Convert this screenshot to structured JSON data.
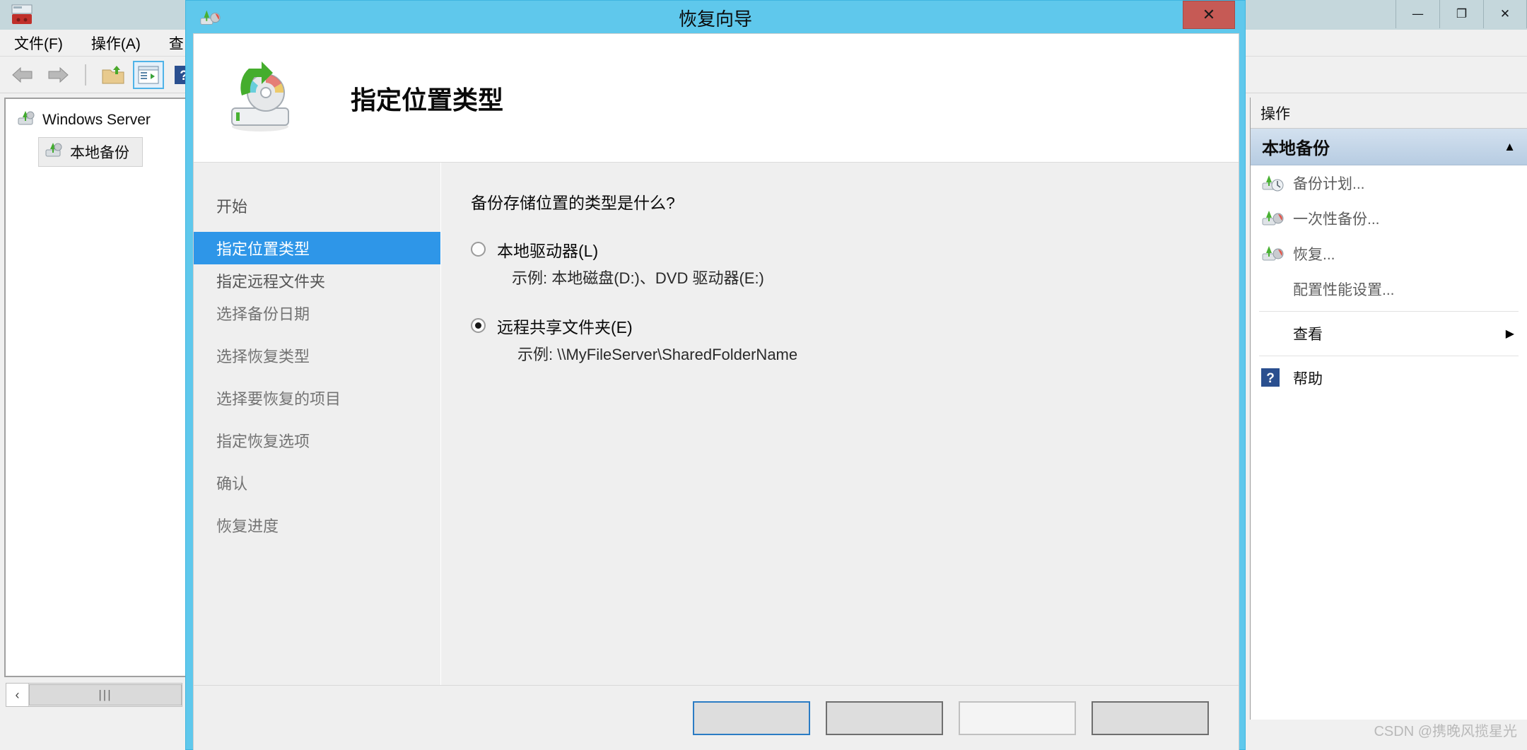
{
  "mmc": {
    "app_icon": "server-backup-icon",
    "window_controls": {
      "minimize": "—",
      "maximize": "❐",
      "close": "✕"
    },
    "menus": [
      {
        "label": "文件(F)",
        "name": "menu-file"
      },
      {
        "label": "操作(A)",
        "name": "menu-action"
      },
      {
        "label": "查",
        "name": "menu-view"
      }
    ],
    "toolbar": [
      {
        "name": "back-arrow-icon"
      },
      {
        "name": "forward-arrow-icon"
      },
      {
        "name": "show-hide-tree-icon"
      },
      {
        "name": "properties-window-icon"
      },
      {
        "name": "help-icon"
      }
    ],
    "tree": [
      {
        "label": "Windows Server",
        "name": "tree-item-windows-server"
      },
      {
        "label": "本地备份",
        "name": "tree-item-local-backup"
      }
    ],
    "scrollbar": {
      "left_arrow": "‹",
      "thumb_glyph": "|||"
    }
  },
  "actions": {
    "header": "操作",
    "group_title": "本地备份",
    "collapse_caret": "▲",
    "items": [
      {
        "label": "备份计划...",
        "icon": "backup-schedule-icon",
        "name": "action-backup-schedule",
        "dimmed": true
      },
      {
        "label": "一次性备份...",
        "icon": "backup-once-icon",
        "name": "action-backup-once",
        "dimmed": true
      },
      {
        "label": "恢复...",
        "icon": "recover-icon",
        "name": "action-recover",
        "dimmed": true
      },
      {
        "label": "配置性能设置...",
        "icon": "",
        "name": "action-configure-performance",
        "dimmed": true
      },
      {
        "label": "查看",
        "icon": "",
        "name": "action-view",
        "dimmed": false,
        "submenu": "▶"
      },
      {
        "label": "帮助",
        "icon": "help-icon",
        "name": "action-help",
        "dimmed": false
      }
    ]
  },
  "wizard": {
    "title": "恢复向导",
    "titlebar_icon": "recover-icon",
    "close_label": "✕",
    "header_icon": "recovery-drive-icon",
    "header_title": "指定位置类型",
    "steps": [
      {
        "label": "开始",
        "name": "wizard-step-getting-started",
        "state": "done"
      },
      {
        "label": "指定位置类型",
        "name": "wizard-step-specify-location-type",
        "state": "current"
      },
      {
        "label": "指定远程文件夹",
        "name": "wizard-step-specify-remote-folder",
        "state": "done"
      },
      {
        "label": "选择备份日期",
        "name": "wizard-step-select-backup-date",
        "state": "pending"
      },
      {
        "label": "选择恢复类型",
        "name": "wizard-step-select-recovery-type",
        "state": "pending"
      },
      {
        "label": "选择要恢复的项目",
        "name": "wizard-step-select-items",
        "state": "pending"
      },
      {
        "label": "指定恢复选项",
        "name": "wizard-step-specify-recovery-options",
        "state": "pending"
      },
      {
        "label": "确认",
        "name": "wizard-step-confirmation",
        "state": "pending"
      },
      {
        "label": "恢复进度",
        "name": "wizard-step-recovery-progress",
        "state": "pending"
      }
    ],
    "question": "备份存储位置的类型是什么?",
    "options": [
      {
        "label": "本地驱动器(L)",
        "example": "示例: 本地磁盘(D:)、DVD 驱动器(E:)",
        "selected": false,
        "name": "radio-local-drive"
      },
      {
        "label": "远程共享文件夹(E)",
        "example": "示例: \\\\MyFileServer\\SharedFolderName",
        "selected": true,
        "name": "radio-remote-shared-folder"
      }
    ],
    "buttons": [
      {
        "label": "",
        "name": "wizard-back-button",
        "style": "primary"
      },
      {
        "label": "",
        "name": "wizard-next-button",
        "style": "normal"
      },
      {
        "label": "",
        "name": "wizard-recover-button",
        "style": "disabled"
      },
      {
        "label": "",
        "name": "wizard-cancel-button",
        "style": "normal"
      }
    ]
  },
  "watermark": "CSDN @携晚风揽星光"
}
